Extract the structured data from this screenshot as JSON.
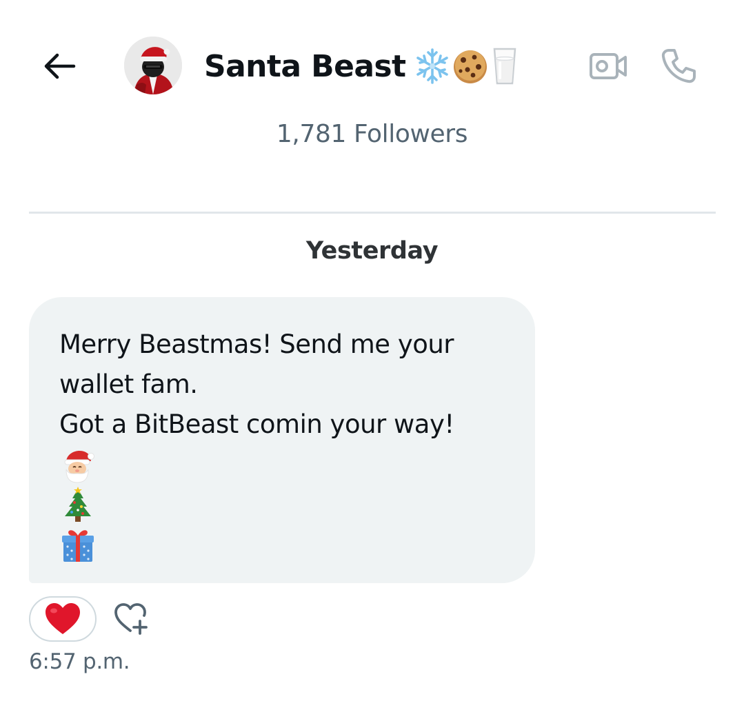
{
  "header": {
    "back_icon": "arrow-left-icon",
    "name": "Santa Beast",
    "name_emojis": [
      "snowflake",
      "cookie",
      "glass-of-milk"
    ],
    "video_icon": "video-camera-icon",
    "phone_icon": "phone-icon",
    "followers": "1,781 Followers"
  },
  "conversation": {
    "date_separator": "Yesterday",
    "messages": [
      {
        "lines": [
          "Merry Beastmas! Send me your",
          "wallet fam.",
          "Got a BitBeast comin your way!"
        ],
        "emojis": [
          "santa-claus",
          "christmas-tree",
          "wrapped-gift"
        ],
        "reaction": "red-heart",
        "time": "6:57 p.m."
      }
    ]
  },
  "colors": {
    "text_primary": "#0f1419",
    "text_secondary": "#536471",
    "bubble_bg": "#eff3f4",
    "divider": "#e1e6ea",
    "icon_gray": "#a9b3ba",
    "heart_red": "#e0162b"
  }
}
